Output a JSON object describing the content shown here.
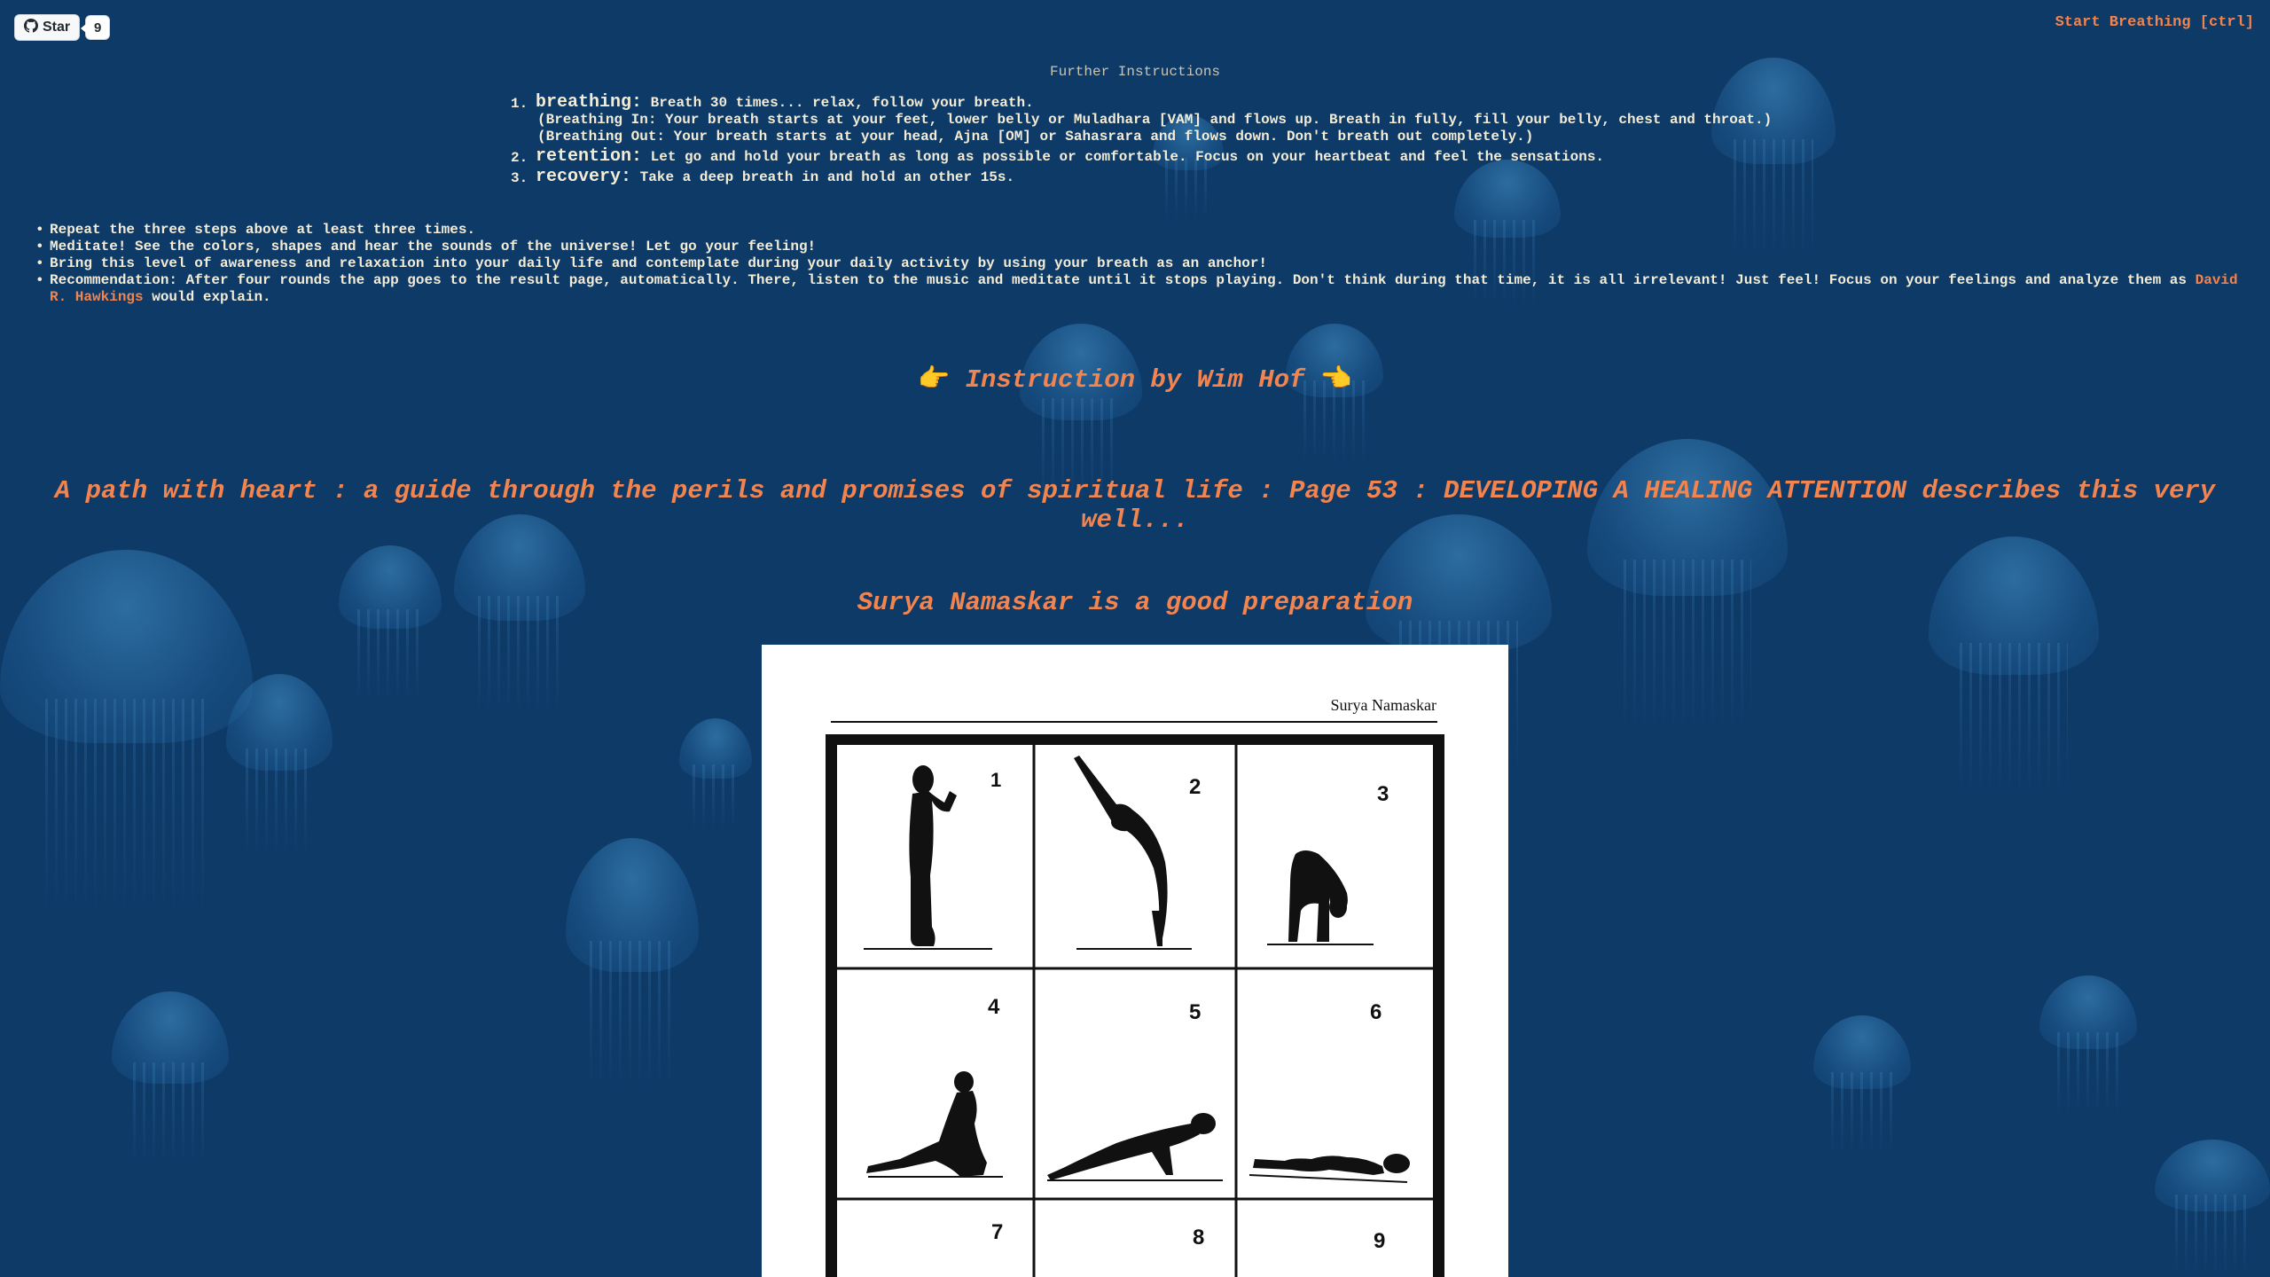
{
  "github": {
    "star_label": "Star",
    "star_count": "9"
  },
  "header": {
    "start_link": "Start Breathing [ctrl]"
  },
  "further_instructions": {
    "title": "Further Instructions",
    "steps": [
      {
        "num": "1.",
        "term": "breathing:",
        "text": "Breath 30 times... relax, follow your breath.",
        "sub": [
          "(Breathing In: Your breath starts at your feet, lower belly or Muladhara [VAM] and flows up. Breath in fully, fill your belly, chest and throat.)",
          "(Breathing Out: Your breath starts at your head, Ajna [OM] or Sahasrara and flows down. Don't breath out completely.)"
        ]
      },
      {
        "num": "2.",
        "term": "retention:",
        "text": "Let go and hold your breath as long as possible or comfortable. Focus on your heartbeat and feel the sensations."
      },
      {
        "num": "3.",
        "term": "recovery:",
        "text": "Take a deep breath in and hold an other 15s."
      }
    ],
    "tips": [
      "Repeat the three steps above at least three times.",
      "Meditate! See the colors, shapes and hear the sounds of the universe! Let go your feeling!",
      "Bring this level of awareness and relaxation into your daily life and contemplate during your daily activity by using your breath as an anchor!"
    ],
    "recommendation": {
      "text_before": "Recommendation: After four rounds the app goes to the result page, automatically. There, listen to the music and meditate until it stops playing. Don't think during that time, it is all irrelevant! Just feel! Focus on your feelings and analyze them as ",
      "link": "David R. Hawkings",
      "text_after": " would explain."
    }
  },
  "wim_hof": {
    "hand_left": "👉",
    "label": "Instruction by Wim Hof",
    "hand_right": "👈"
  },
  "book_link": "A path with heart : a guide through the perils and promises of spiritual life : Page 53 : DEVELOPING A HEALING ATTENTION describes this very well...",
  "surya": {
    "title": "Surya Namaskar is a good preparation",
    "image_caption": "Surya Namaskar",
    "panel_numbers": [
      "1",
      "2",
      "3",
      "4",
      "5",
      "6",
      "7",
      "8",
      "9"
    ]
  },
  "colors": {
    "background": "#0e3a68",
    "accent_orange": "#f2844f",
    "text_cream": "#f3ecd6",
    "hand_yellow": "#f2c94c"
  },
  "icons": [
    "github-icon",
    "pointing-right-hand-icon",
    "pointing-left-hand-icon"
  ]
}
